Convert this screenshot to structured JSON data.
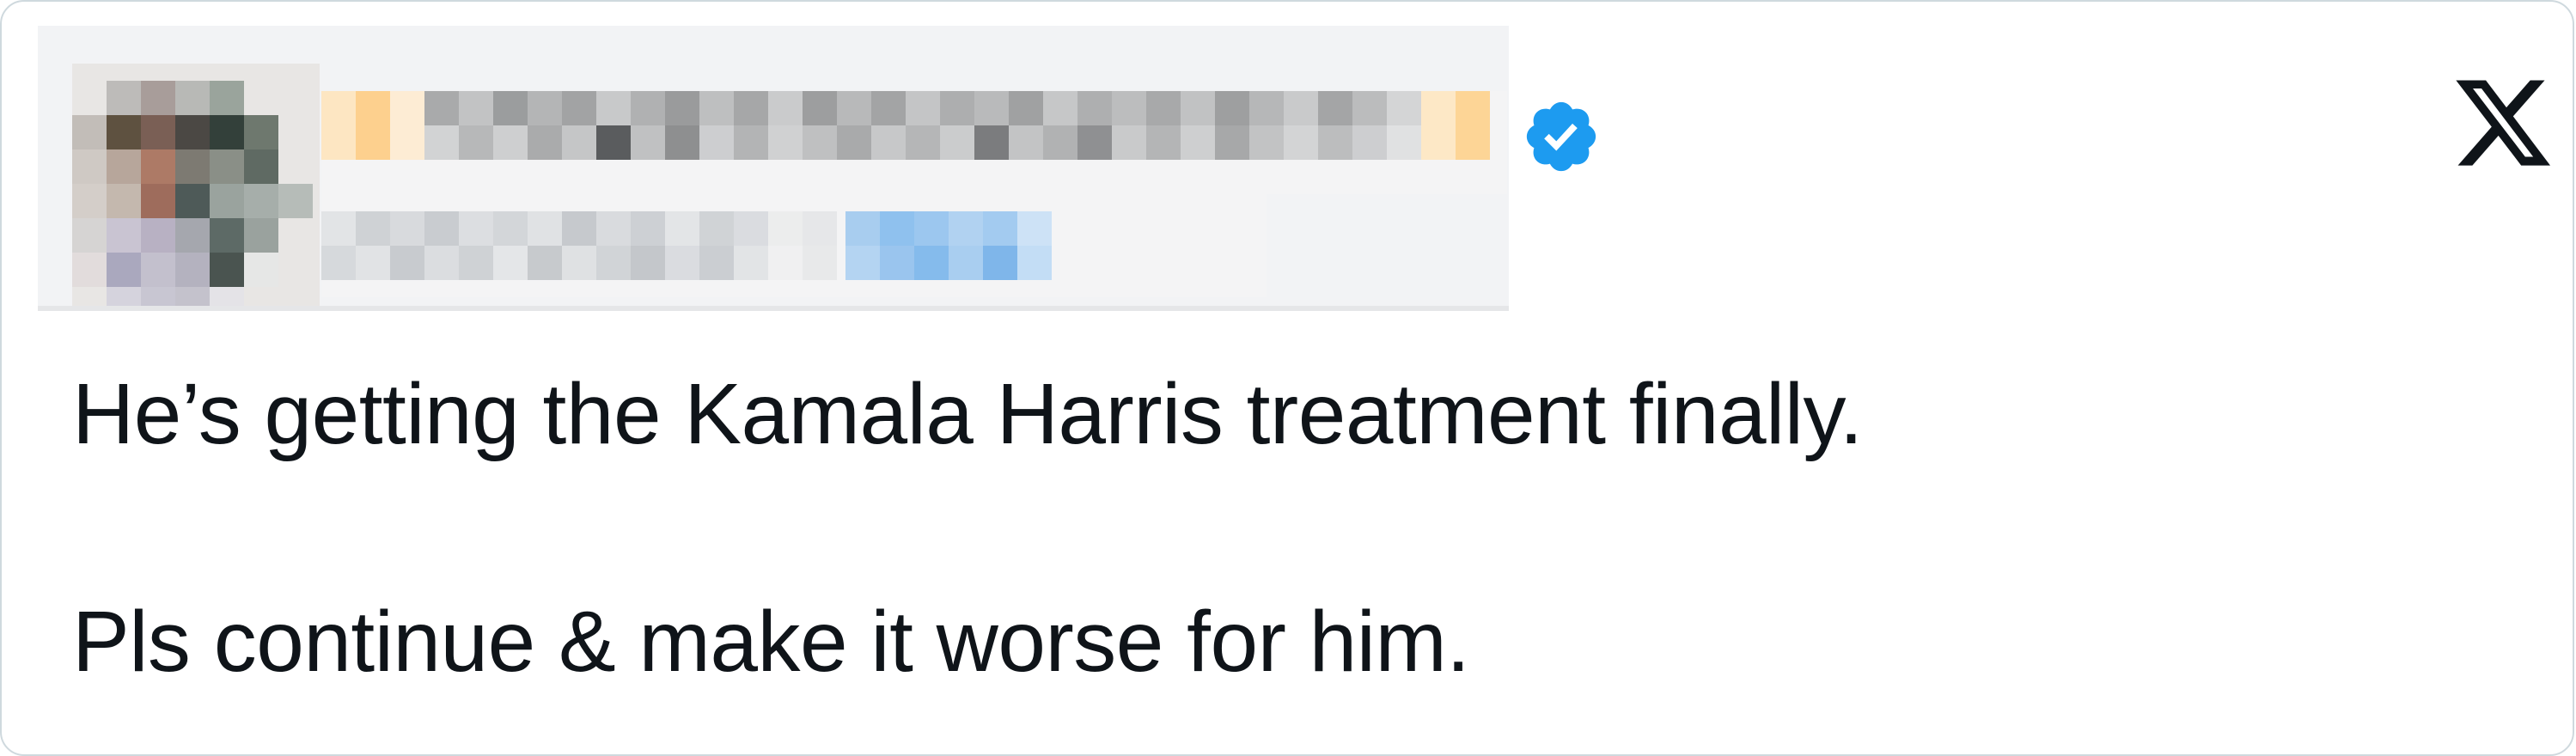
{
  "tweet": {
    "paragraphs": [
      "He’s getting the Kamala Harris treatment finally.",
      "Pls continue & make it worse for him."
    ]
  },
  "author": {
    "verified": true,
    "avatar_icon": "avatar-pixelated",
    "name_redacted": true
  },
  "brand": {
    "logo": "x-logo-icon",
    "verified_color": "#1d9bf0",
    "text_color": "#0f1419"
  }
}
